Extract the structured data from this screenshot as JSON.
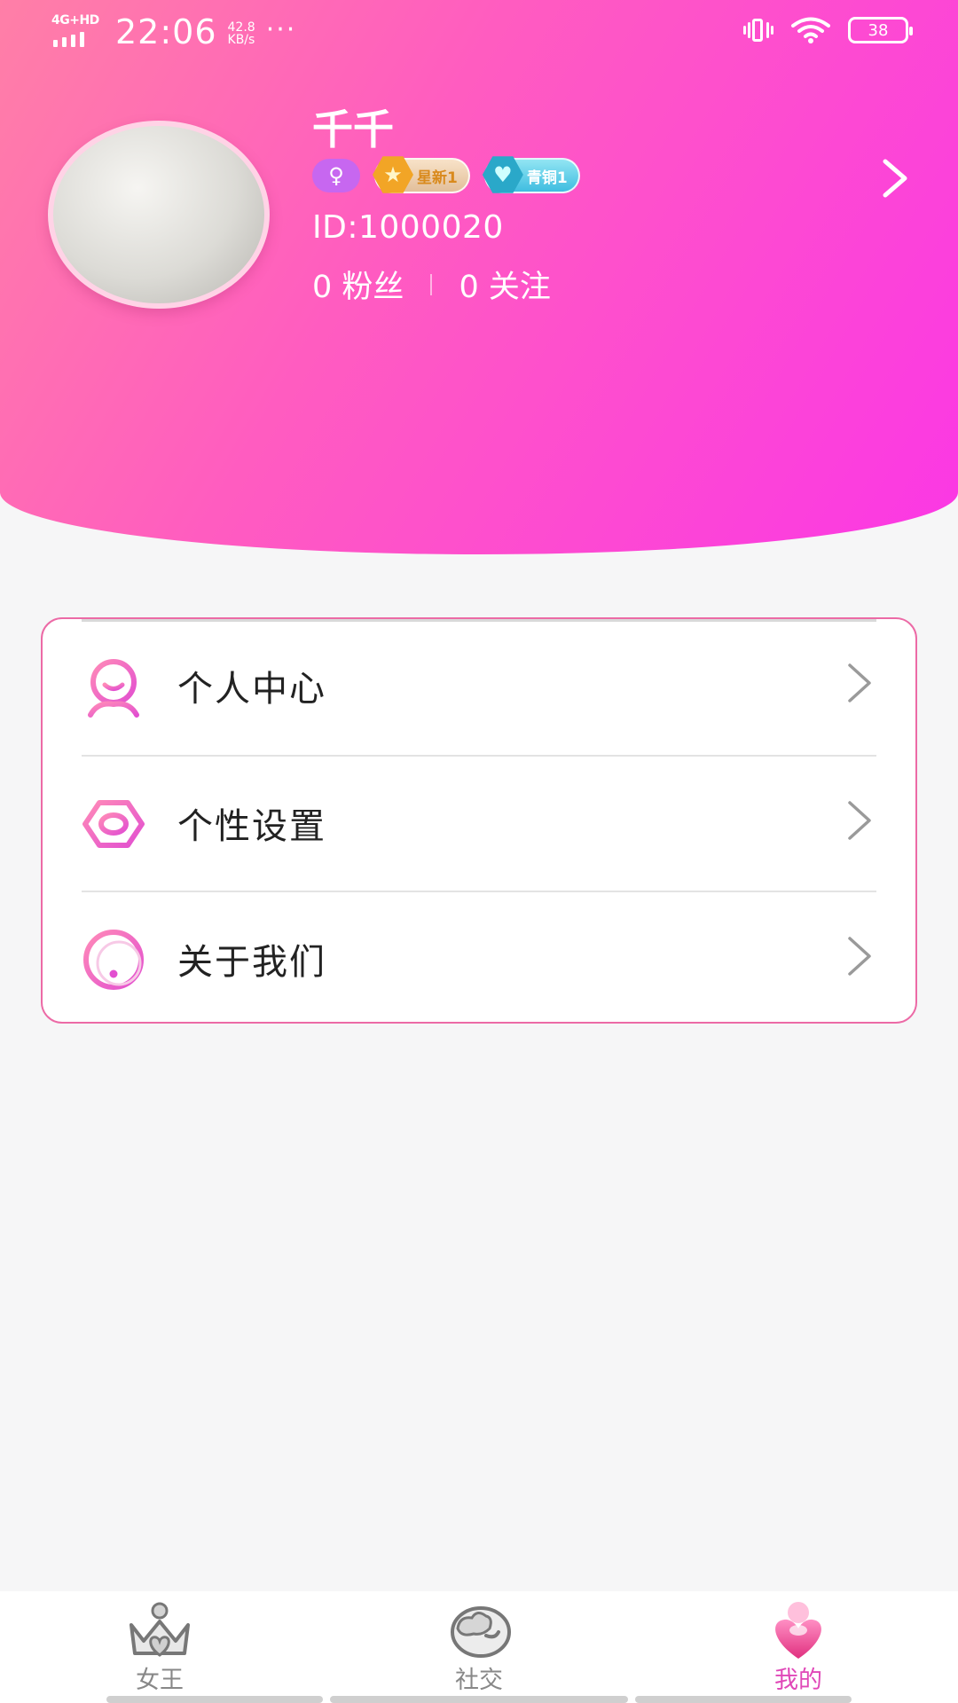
{
  "status_bar": {
    "network": "4G+HD",
    "time": "22:06",
    "speed_value": "42.8",
    "speed_unit": "KB/s",
    "more": "···",
    "battery": "38"
  },
  "profile": {
    "name": "千千",
    "gender_symbol": "♀",
    "badges": [
      {
        "label": "星新1",
        "icon": "star-icon"
      },
      {
        "label": "青铜1",
        "icon": "heart-icon"
      }
    ],
    "id_text": "ID:1000020",
    "fans_count": "0",
    "fans_label": "粉丝",
    "following_count": "0",
    "following_label": "关注"
  },
  "menu": {
    "items": [
      {
        "label": "个人中心",
        "icon": "user-smile-icon"
      },
      {
        "label": "个性设置",
        "icon": "settings-hexagon-icon"
      },
      {
        "label": "关于我们",
        "icon": "exclamation-circle-icon"
      }
    ]
  },
  "bottom_nav": {
    "items": [
      {
        "label": "女王",
        "icon": "crown-heart-icon"
      },
      {
        "label": "社交",
        "icon": "chat-bubble-icon"
      },
      {
        "label": "我的",
        "icon": "heart-profile-icon",
        "active": true
      }
    ]
  },
  "colors": {
    "gradient_start": "#ff7fa7",
    "gradient_end": "#fb37e5",
    "accent": "#e048b8",
    "card_border": "#ec6aa6"
  }
}
